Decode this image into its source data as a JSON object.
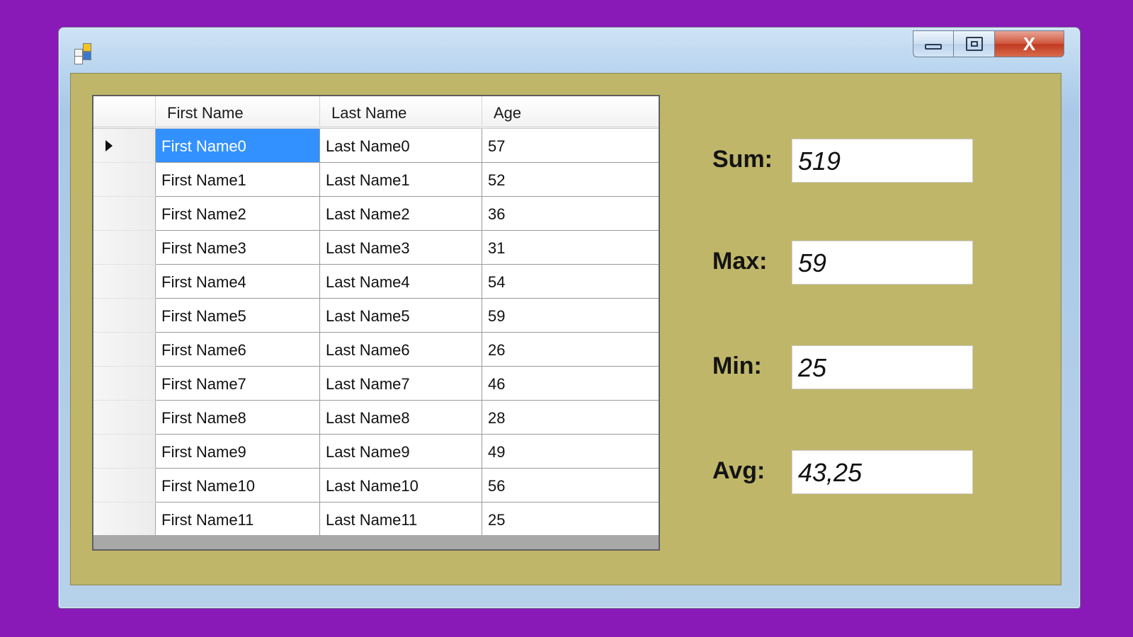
{
  "window": {
    "colors": {
      "background": "#8a1ab8",
      "client": "#bfb66a",
      "selection": "#3391ff",
      "close": "#c0391f"
    },
    "caption": {
      "close_label": "X"
    }
  },
  "grid": {
    "columns": [
      "First Name",
      "Last Name",
      "Age"
    ],
    "rows": [
      {
        "first": "First Name0",
        "last": "Last Name0",
        "age": "57"
      },
      {
        "first": "First Name1",
        "last": "Last Name1",
        "age": "52"
      },
      {
        "first": "First Name2",
        "last": "Last Name2",
        "age": "36"
      },
      {
        "first": "First Name3",
        "last": "Last Name3",
        "age": "31"
      },
      {
        "first": "First Name4",
        "last": "Last Name4",
        "age": "54"
      },
      {
        "first": "First Name5",
        "last": "Last Name5",
        "age": "59"
      },
      {
        "first": "First Name6",
        "last": "Last Name6",
        "age": "26"
      },
      {
        "first": "First Name7",
        "last": "Last Name7",
        "age": "46"
      },
      {
        "first": "First Name8",
        "last": "Last Name8",
        "age": "28"
      },
      {
        "first": "First Name9",
        "last": "Last Name9",
        "age": "49"
      },
      {
        "first": "First Name10",
        "last": "Last Name10",
        "age": "56"
      },
      {
        "first": "First Name11",
        "last": "Last Name11",
        "age": "25"
      }
    ]
  },
  "stats": {
    "sum": {
      "label": "Sum:",
      "value": "519"
    },
    "max": {
      "label": "Max:",
      "value": "59"
    },
    "min": {
      "label": "Min:",
      "value": "25"
    },
    "avg": {
      "label": "Avg:",
      "value": "43,25"
    }
  }
}
